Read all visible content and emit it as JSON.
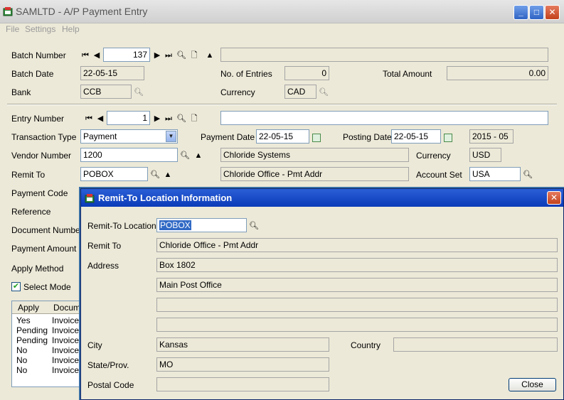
{
  "window": {
    "title": "SAMLTD - A/P Payment Entry",
    "minimize_glyph": "_",
    "maximize_glyph": "□",
    "close_glyph": "✕"
  },
  "menu": [
    "File",
    "Settings",
    "Help"
  ],
  "batch": {
    "number_label": "Batch Number",
    "number": "137",
    "description": "",
    "date_label": "Batch Date",
    "date": "22-05-15",
    "entries_label": "No. of Entries",
    "entries": "0",
    "total_label": "Total Amount",
    "total": "0.00",
    "bank_label": "Bank",
    "bank": "CCB",
    "currency_label": "Currency",
    "currency": "CAD"
  },
  "entry": {
    "number_label": "Entry Number",
    "number": "1",
    "description": "",
    "trans_type_label": "Transaction Type",
    "trans_type": "Payment",
    "payment_date_label": "Payment Date",
    "payment_date": "22-05-15",
    "posting_date_label": "Posting Date",
    "posting_date": "22-05-15",
    "period": "2015 - 05",
    "vendor_label": "Vendor Number",
    "vendor_number": "1200",
    "vendor_name": "Chloride Systems",
    "vendor_currency_label": "Currency",
    "vendor_currency": "USD",
    "remit_label": "Remit To",
    "remit_to": "POBOX",
    "remit_name": "Chloride Office - Pmt Addr",
    "account_set_label": "Account Set",
    "account_set": "USA",
    "payment_code_label": "Payment Code",
    "reference_label": "Reference",
    "document_number_label": "Document Number",
    "payment_amount_label": "Payment Amount",
    "apply_method_label": "Apply Method",
    "select_mode_label": "Select Mode",
    "select_mode_checked": true
  },
  "grid": {
    "columns": [
      "Apply",
      "Docume"
    ],
    "rows": [
      {
        "apply": "Yes",
        "doc": "Invoice"
      },
      {
        "apply": "Pending",
        "doc": "Invoice"
      },
      {
        "apply": "Pending",
        "doc": "Invoice"
      },
      {
        "apply": "No",
        "doc": "Invoice"
      },
      {
        "apply": "No",
        "doc": "Invoice"
      },
      {
        "apply": "No",
        "doc": "Invoice"
      }
    ]
  },
  "dialog": {
    "title": "Remit-To Location Information",
    "location_label": "Remit-To Location",
    "location": "POBOX",
    "remit_to_label": "Remit To",
    "remit_to": "Chloride Office - Pmt Addr",
    "address_label": "Address",
    "address1": "Box 1802",
    "address2": "Main Post Office",
    "address3": "",
    "address4": "",
    "city_label": "City",
    "city": "Kansas",
    "country_label": "Country",
    "country": "",
    "state_label": "State/Prov.",
    "state": "MO",
    "postal_label": "Postal Code",
    "postal": "",
    "close_label": "Close",
    "close_glyph": "✕"
  },
  "colors": {
    "accent_title": "#0a3ab8",
    "window_bg": "#ece9d8"
  }
}
